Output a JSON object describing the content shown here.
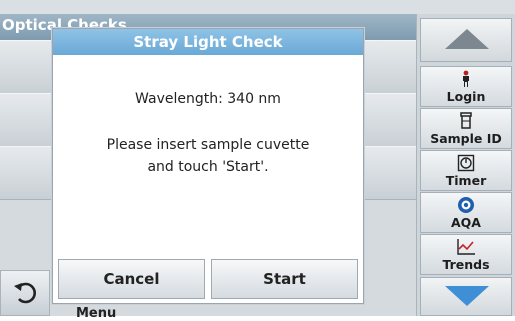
{
  "background": {
    "title": "Optical Checks",
    "menu_label": "Menu"
  },
  "dialog": {
    "title": "Stray Light Check",
    "wavelength_text": "Wavelength: 340 nm",
    "instruction_line1": "Please insert sample cuvette",
    "instruction_line2": "and touch 'Start'.",
    "cancel_label": "Cancel",
    "start_label": "Start"
  },
  "sidebar": {
    "items": [
      {
        "label": "Login",
        "icon": "person-icon"
      },
      {
        "label": "Sample ID",
        "icon": "cuvette-icon"
      },
      {
        "label": "Timer",
        "icon": "timer-icon"
      },
      {
        "label": "AQA",
        "icon": "aqa-icon"
      },
      {
        "label": "Trends",
        "icon": "trends-icon"
      }
    ]
  },
  "colors": {
    "dialog_title_bg": "#6aa9d6",
    "scroll_down_arrow": "#3f8fd6",
    "scroll_up_arrow": "#7d8790"
  }
}
